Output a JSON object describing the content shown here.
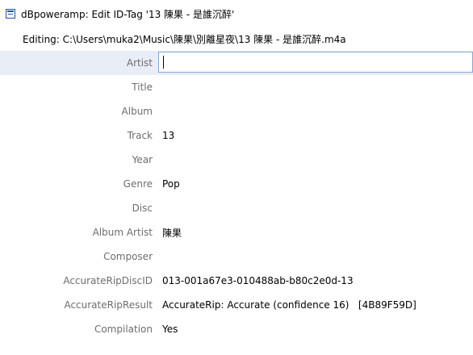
{
  "window": {
    "title": "dBpoweramp: Edit ID-Tag '13 陳果 - 是誰沉醉'",
    "editing": "Editing: C:\\Users\\muka2\\Music\\陳果\\別離星夜\\13 陳果 - 是誰沉醉.m4a"
  },
  "fields": [
    {
      "label": "Artist",
      "value": ""
    },
    {
      "label": "Title",
      "value": ""
    },
    {
      "label": "Album",
      "value": ""
    },
    {
      "label": "Track",
      "value": "13"
    },
    {
      "label": "Year",
      "value": ""
    },
    {
      "label": "Genre",
      "value": "Pop"
    },
    {
      "label": "Disc",
      "value": ""
    },
    {
      "label": "Album Artist",
      "value": "陳果"
    },
    {
      "label": "Composer",
      "value": ""
    },
    {
      "label": "AccurateRipDiscID",
      "value": "013-001a67e3-010488ab-b80c2e0d-13"
    },
    {
      "label": "AccurateRipResult",
      "value": "AccurateRip: Accurate (confidence 16)   [4B89F59D]"
    },
    {
      "label": "Compilation",
      "value": "Yes"
    }
  ]
}
